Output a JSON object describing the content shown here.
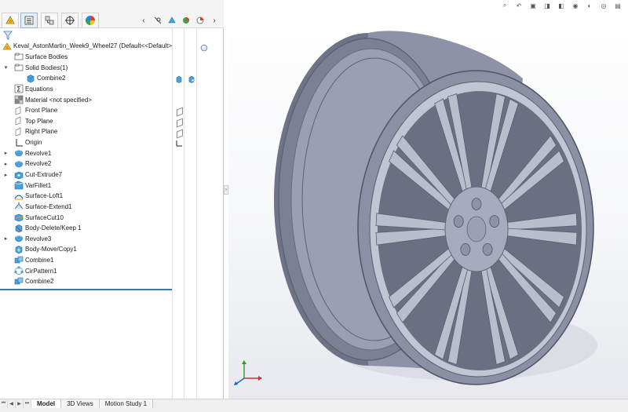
{
  "feature_manager": {
    "tabs": [
      {
        "name": "featuremanager-tab-icon"
      },
      {
        "name": "propertymanager-tab-icon"
      },
      {
        "name": "configurationmanager-tab-icon"
      },
      {
        "name": "dimxpert-tab-icon"
      },
      {
        "name": "appearance-tab-icon"
      }
    ],
    "tree": [
      {
        "label": "Keval_AstonMartin_Week9_Wheel27  (Default<<Default>",
        "icon": "part-icon",
        "arrow": "",
        "indent": 0
      },
      {
        "label": "Surface Bodies",
        "icon": "folder-icon",
        "arrow": "",
        "indent": 1
      },
      {
        "label": "Solid Bodies(1)",
        "icon": "folder-icon",
        "arrow": "▾",
        "indent": 1
      },
      {
        "label": "Combine2",
        "icon": "solid-body-icon",
        "arrow": "",
        "indent": 2
      },
      {
        "label": "Equations",
        "icon": "equations-icon",
        "arrow": "",
        "indent": 1
      },
      {
        "label": "Material <not specified>",
        "icon": "material-icon",
        "arrow": "",
        "indent": 1
      },
      {
        "label": "Front Plane",
        "icon": "plane-icon",
        "arrow": "",
        "indent": 1
      },
      {
        "label": "Top Plane",
        "icon": "plane-icon",
        "arrow": "",
        "indent": 1
      },
      {
        "label": "Right Plane",
        "icon": "plane-icon",
        "arrow": "",
        "indent": 1
      },
      {
        "label": "Origin",
        "icon": "origin-icon",
        "arrow": "",
        "indent": 1
      },
      {
        "label": "Revolve1",
        "icon": "revolve-icon",
        "arrow": "▸",
        "indent": 1
      },
      {
        "label": "Revolve2",
        "icon": "revolve-icon",
        "arrow": "▸",
        "indent": 1
      },
      {
        "label": "Cut-Extrude7",
        "icon": "cut-extrude-icon",
        "arrow": "▸",
        "indent": 1
      },
      {
        "label": "VarFillet1",
        "icon": "fillet-icon",
        "arrow": "",
        "indent": 1
      },
      {
        "label": "Surface-Loft1",
        "icon": "surface-loft-icon",
        "arrow": "",
        "indent": 1
      },
      {
        "label": "Surface-Extend1",
        "icon": "surface-extend-icon",
        "arrow": "",
        "indent": 1
      },
      {
        "label": "SurfaceCut10",
        "icon": "surface-cut-icon",
        "arrow": "",
        "indent": 1
      },
      {
        "label": "Body-Delete/Keep 1",
        "icon": "body-delete-icon",
        "arrow": "",
        "indent": 1
      },
      {
        "label": "Revolve3",
        "icon": "revolve-icon",
        "arrow": "▸",
        "indent": 1
      },
      {
        "label": "Body-Move/Copy1",
        "icon": "body-move-icon",
        "arrow": "",
        "indent": 1
      },
      {
        "label": "Combine1",
        "icon": "combine-icon",
        "arrow": "",
        "indent": 1
      },
      {
        "label": "CirPattern1",
        "icon": "circular-pattern-icon",
        "arrow": "",
        "indent": 1
      },
      {
        "label": "Combine2",
        "icon": "combine-icon",
        "arrow": "",
        "indent": 1
      }
    ]
  },
  "bottom_tabs": [
    {
      "label": "Model",
      "active": true
    },
    {
      "label": "3D Views",
      "active": false
    },
    {
      "label": "Motion Study 1",
      "active": false
    }
  ],
  "colors": {
    "accent": "#3d73b8",
    "model_fill": "#9aa0b4",
    "model_shadow": "#5f6477",
    "viewport_bottom": "#e7e9ee"
  }
}
